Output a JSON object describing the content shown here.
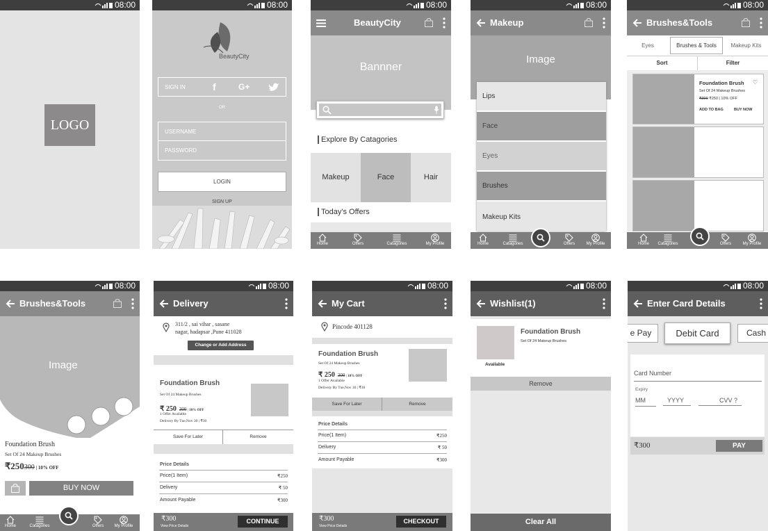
{
  "status": {
    "time": "08:00"
  },
  "splash": {
    "logo": "LOGO"
  },
  "login": {
    "brand": "BeautyCity",
    "sign_in": "SIGN IN",
    "or": "OR",
    "username": "USERNAME",
    "password": "PASSWORD",
    "login": "LOGIN",
    "signup": "SIGN UP"
  },
  "home": {
    "title": "BeautyCity",
    "banner": "Bannner",
    "explore": "Explore By Catagories",
    "categories": [
      "Makeup",
      "Face",
      "Hair"
    ],
    "offers": "Today's Offers"
  },
  "nav": {
    "home": "Home",
    "offers": "Offers",
    "categories": "Catagories",
    "profile": "My Profile"
  },
  "makeup": {
    "title": "Makeup",
    "image": "Image",
    "items": [
      "Lips",
      "Face",
      "Eyes",
      "Brushes",
      "Makeup Kits"
    ]
  },
  "brushes": {
    "title": "Brushes&Tools",
    "tabs": [
      "Eyes",
      "Brushes & Tools",
      "Makeup Kits"
    ],
    "sort": "Sort",
    "filter": "Filter",
    "product_name": "Foundation Brush",
    "product_sub": "Set Of 24 Makeup Brushes",
    "price_old": "₹300",
    "price_new": "₹250",
    "discount": "10% OFF",
    "add_to_bag": "ADD TO BAG",
    "buy_now": "BUY NOW"
  },
  "detail": {
    "title": "Brushes&Tools",
    "image": "Image",
    "name": "Foundation Brush",
    "sub": "Set Of 24 Makeup Brushes",
    "price": "₹250",
    "old": "300",
    "off": "10% OFF",
    "buy": "BUY NOW"
  },
  "delivery": {
    "title": "Delivery",
    "addr1": "311/2 , sai vihar , sasane",
    "addr2": "nagar, hadapsar ,Pune 411028",
    "change": "Change or Add Address",
    "name": "Foundation Brush",
    "sub": "Set Of 24 Makeup Brushes",
    "price": "₹ 250",
    "old": "300",
    "off": "10% OFF",
    "offer": "1 Offer Available",
    "by": "Delivery By Tue,Nov 30 | ₹30",
    "save": "Save For Later",
    "remove": "Remove",
    "pd": "Price Details",
    "price_label": "Price(1 Item)",
    "price_val": "₹250",
    "del_label": "Delivery",
    "del_val": "₹  50",
    "amt_label": "Amount Payable",
    "amt_val": "₹300",
    "total": "₹300",
    "view": "View Price Details",
    "continue": "CONTINUE"
  },
  "cart": {
    "title": "My Cart",
    "pincode": "Pincode 401128",
    "name": "Foundation Brush",
    "sub": "Set Of 24 Makeup Brushes",
    "price": "₹ 250",
    "old": "300",
    "off": "10% OFF",
    "offer": "1 Offer Available",
    "by": "Delivery By Tue,Nov 30 | ₹30",
    "save": "Save For Later",
    "remove": "Remove",
    "pd": "Price Details",
    "price_label": "Price(1 Item)",
    "price_val": "₹250",
    "del_label": "Delivery",
    "del_val": "₹  50",
    "amt_label": "Amount Payable",
    "amt_val": "₹300",
    "total": "₹300",
    "view": "View Price Details",
    "checkout": "CHECKOUT"
  },
  "wishlist": {
    "title": "Wishlist(1)",
    "name": "Foundation Brush",
    "sub": "Set Of 24 Makeup Brushes",
    "available": "Available",
    "remove": "Remove",
    "clear": "Clear All"
  },
  "card": {
    "title": "Enter Card Details",
    "tabs": [
      "e Pay",
      "Debit Card",
      "Cash"
    ],
    "number": "Card Number",
    "expiry": "Expiry",
    "mm": "MM",
    "yyyy": "YYYY",
    "cvv": "CVV ?",
    "total": "₹300",
    "pay": "PAY"
  }
}
